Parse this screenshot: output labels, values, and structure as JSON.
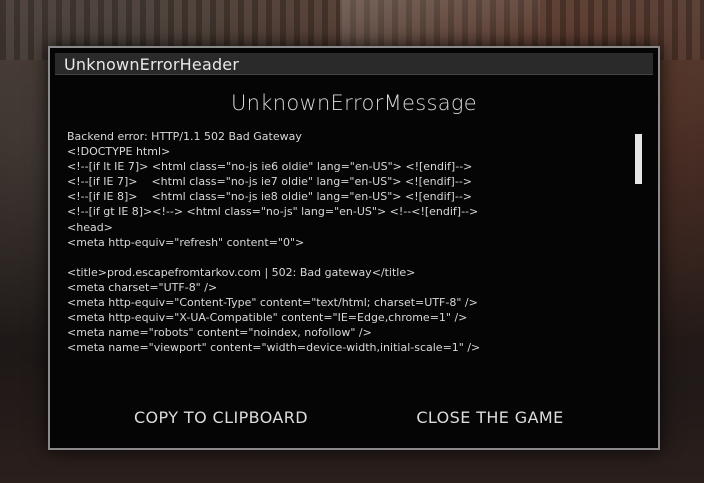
{
  "dialog": {
    "header_title": "UnknownErrorHeader",
    "message_title": "UnknownErrorMessage",
    "log_lines": [
      "Backend error: HTTP/1.1 502 Bad Gateway",
      "<!DOCTYPE html>",
      "<!--[if lt IE 7]> <html class=\"no-js ie6 oldie\" lang=\"en-US\"> <![endif]-->",
      "<!--[if IE 7]>    <html class=\"no-js ie7 oldie\" lang=\"en-US\"> <![endif]-->",
      "<!--[if IE 8]>    <html class=\"no-js ie8 oldie\" lang=\"en-US\"> <![endif]-->",
      "<!--[if gt IE 8]><!--> <html class=\"no-js\" lang=\"en-US\"> <!--<![endif]-->",
      "<head>",
      "<meta http-equiv=\"refresh\" content=\"0\">",
      "",
      "<title>prod.escapefromtarkov.com | 502: Bad gateway</title>",
      "<meta charset=\"UTF-8\" />",
      "<meta http-equiv=\"Content-Type\" content=\"text/html; charset=UTF-8\" />",
      "<meta http-equiv=\"X-UA-Compatible\" content=\"IE=Edge,chrome=1\" />",
      "<meta name=\"robots\" content=\"noindex, nofollow\" />",
      "<meta name=\"viewport\" content=\"width=device-width,initial-scale=1\" />"
    ],
    "buttons": {
      "copy_label": "COPY TO CLIPBOARD",
      "close_label": "CLOSE THE GAME"
    }
  }
}
